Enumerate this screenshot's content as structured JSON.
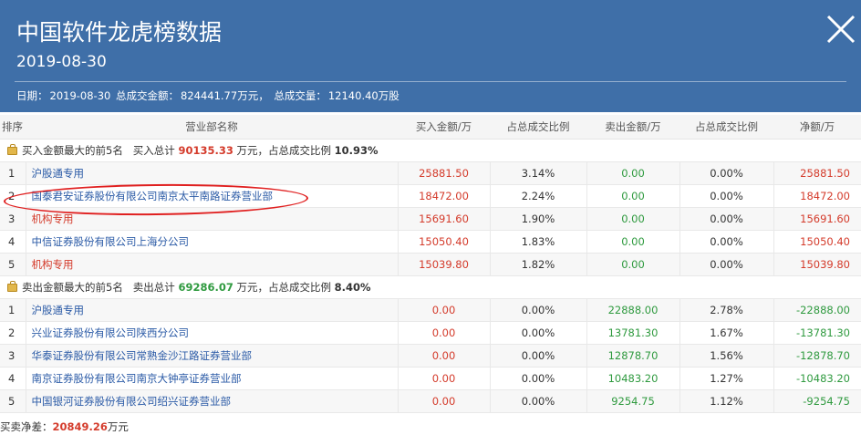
{
  "header": {
    "title": "中国软件龙虎榜数据",
    "date": "2019-08-30",
    "summary_label_date": "日期：",
    "summary_date": "2019-08-30",
    "summary_label_amount": "总成交金额：",
    "summary_amount": "824441.77万元，",
    "summary_label_volume": "总成交量：",
    "summary_volume": "12140.40万股"
  },
  "columns": [
    "排序",
    "营业部名称",
    "买入金额/万",
    "占总成交比例",
    "卖出金额/万",
    "占总成交比例",
    "净额/万"
  ],
  "buy_section": {
    "label": "买入金额最大的前5名",
    "total_label": "买入总计",
    "total": "90135.33",
    "unit_text": "万元，占总成交比例",
    "ratio": "10.93%",
    "rows": [
      {
        "rank": "1",
        "name": "沪股通专用",
        "buy": "25881.50",
        "buy_ratio": "3.14%",
        "sell": "0.00",
        "sell_ratio": "0.00%",
        "net": "25881.50"
      },
      {
        "rank": "2",
        "name": "国泰君安证券股份有限公司南京太平南路证券营业部",
        "buy": "18472.00",
        "buy_ratio": "2.24%",
        "sell": "0.00",
        "sell_ratio": "0.00%",
        "net": "18472.00"
      },
      {
        "rank": "3",
        "name": "机构专用",
        "buy": "15691.60",
        "buy_ratio": "1.90%",
        "sell": "0.00",
        "sell_ratio": "0.00%",
        "net": "15691.60"
      },
      {
        "rank": "4",
        "name": "中信证券股份有限公司上海分公司",
        "buy": "15050.40",
        "buy_ratio": "1.83%",
        "sell": "0.00",
        "sell_ratio": "0.00%",
        "net": "15050.40"
      },
      {
        "rank": "5",
        "name": "机构专用",
        "buy": "15039.80",
        "buy_ratio": "1.82%",
        "sell": "0.00",
        "sell_ratio": "0.00%",
        "net": "15039.80"
      }
    ]
  },
  "sell_section": {
    "label": "卖出金额最大的前5名",
    "total_label": "卖出总计",
    "total": "69286.07",
    "unit_text": "万元，占总成交比例",
    "ratio": "8.40%",
    "rows": [
      {
        "rank": "1",
        "name": "沪股通专用",
        "buy": "0.00",
        "buy_ratio": "0.00%",
        "sell": "22888.00",
        "sell_ratio": "2.78%",
        "net": "-22888.00"
      },
      {
        "rank": "2",
        "name": "兴业证券股份有限公司陕西分公司",
        "buy": "0.00",
        "buy_ratio": "0.00%",
        "sell": "13781.30",
        "sell_ratio": "1.67%",
        "net": "-13781.30"
      },
      {
        "rank": "3",
        "name": "华泰证券股份有限公司常熟金沙江路证券营业部",
        "buy": "0.00",
        "buy_ratio": "0.00%",
        "sell": "12878.70",
        "sell_ratio": "1.56%",
        "net": "-12878.70"
      },
      {
        "rank": "4",
        "name": "南京证券股份有限公司南京大钟亭证券营业部",
        "buy": "0.00",
        "buy_ratio": "0.00%",
        "sell": "10483.20",
        "sell_ratio": "1.27%",
        "net": "-10483.20"
      },
      {
        "rank": "5",
        "name": "中国银河证券股份有限公司绍兴证券营业部",
        "buy": "0.00",
        "buy_ratio": "0.00%",
        "sell": "9254.75",
        "sell_ratio": "1.12%",
        "net": "-9254.75"
      }
    ]
  },
  "footer": {
    "label": "买卖净差：",
    "value": "20849.26",
    "unit": "万元"
  },
  "colors": {
    "header_bg": "#3f6fa8",
    "buy_red": "#d43b2b",
    "sell_green": "#2f9a3f",
    "link_blue": "#2a5aa6",
    "annotation_red": "#e02020"
  },
  "icons": [
    "close-icon",
    "bag-icon"
  ]
}
